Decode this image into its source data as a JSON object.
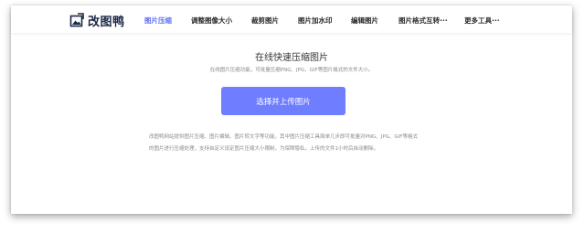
{
  "brand": {
    "name": "改图鸭",
    "icon": "photo-edit-icon",
    "icon_color": "#1b2a47"
  },
  "nav": {
    "items": [
      {
        "label": "图片压缩",
        "active": true
      },
      {
        "label": "调整图像大小",
        "active": false
      },
      {
        "label": "裁剪图片",
        "active": false
      },
      {
        "label": "图片加水印",
        "active": false
      },
      {
        "label": "编辑图片",
        "active": false
      },
      {
        "label": "图片格式互转···",
        "active": false
      },
      {
        "label": "更多工具···",
        "active": false
      }
    ],
    "active_color": "#6170f2"
  },
  "main": {
    "title": "在线快速压缩图片",
    "subtitle": "在线图片压缩功能，可批量压缩PNG、JPG、GIF等图片格式的文件大小。",
    "upload_button": "选择并上传图片",
    "button_color": "#6f7dff",
    "description_line1": "改图鸭网站提供图片压缩、图片编辑、图片转文字等功能，其中图片压缩工具简单几步即可批量对PNG、JPG、GIF等格式",
    "description_line2": "的图片进行压缩处理，支持自定义设定图片压缩大小限制，为保障隐私，上传的文件1小时后自动删除。"
  }
}
